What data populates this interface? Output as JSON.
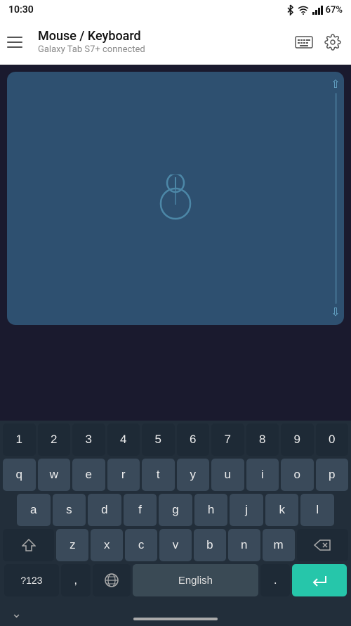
{
  "statusBar": {
    "time": "10:30",
    "battery": "67%"
  },
  "topBar": {
    "title": "Mouse / Keyboard",
    "subtitle": "Galaxy Tab S7+ connected"
  },
  "touchpad": {
    "mouseIconLabel": "mouse"
  },
  "keyboard": {
    "row1": [
      "1",
      "2",
      "3",
      "4",
      "5",
      "6",
      "7",
      "8",
      "9",
      "0"
    ],
    "row2": [
      "q",
      "w",
      "e",
      "r",
      "t",
      "y",
      "u",
      "i",
      "o",
      "p"
    ],
    "row3": [
      "a",
      "s",
      "d",
      "f",
      "g",
      "h",
      "j",
      "k",
      "l"
    ],
    "row4": [
      "z",
      "x",
      "c",
      "v",
      "b",
      "n",
      "m"
    ],
    "bottomRow": {
      "num_label": "?123",
      "comma": ",",
      "globe": "🌐",
      "space_label": "English",
      "period": ".",
      "enter": "↵"
    },
    "chevron": "∨"
  }
}
